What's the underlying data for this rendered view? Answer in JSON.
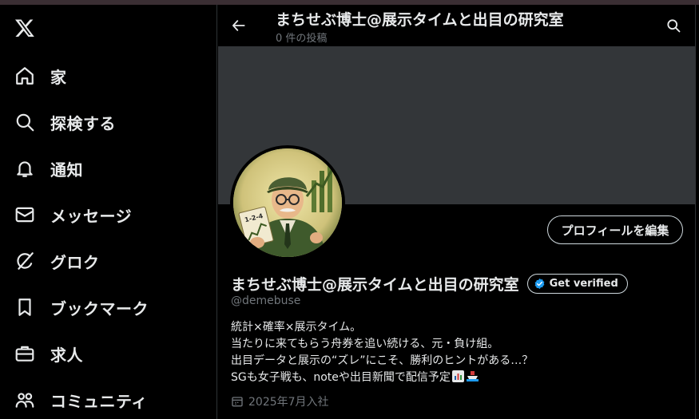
{
  "sidebar": {
    "logo_icon": "x-logo-icon",
    "items": [
      {
        "label": "家",
        "icon": "home-icon"
      },
      {
        "label": "探検する",
        "icon": "search-icon"
      },
      {
        "label": "通知",
        "icon": "bell-icon"
      },
      {
        "label": "メッセージ",
        "icon": "mail-icon"
      },
      {
        "label": "グロク",
        "icon": "grok-icon"
      },
      {
        "label": "ブックマーク",
        "icon": "bookmark-icon"
      },
      {
        "label": "求人",
        "icon": "briefcase-icon"
      },
      {
        "label": "コミュニティ",
        "icon": "people-icon"
      }
    ]
  },
  "header": {
    "title": "まちせぶ博士@展示タイムと出目の研究室",
    "post_count": "0 件の投稿"
  },
  "profile": {
    "edit_button": "プロフィールを編集",
    "display_name": "まちせぶ博士@展示タイムと出目の研究室",
    "verify_label": "Get verified",
    "handle": "@demebuse",
    "bio_lines": [
      "統計×確率×展示タイム。",
      "当たりに来てもらう舟券を追い続ける、元・負け組。",
      "出目データと展示の“ズレ”にこそ、勝利のヒントがある…？",
      "SGも女子戦も、noteや出目新聞で配信予定"
    ],
    "joined": "2025年7月入社",
    "avatar_ticket_text": "1-2-4"
  },
  "colors": {
    "background": "#000000",
    "banner": "#333639",
    "text_primary": "#e7e9ea",
    "text_secondary": "#71767b",
    "verify_blue": "#1d9bf0",
    "border": "#2f3336"
  }
}
